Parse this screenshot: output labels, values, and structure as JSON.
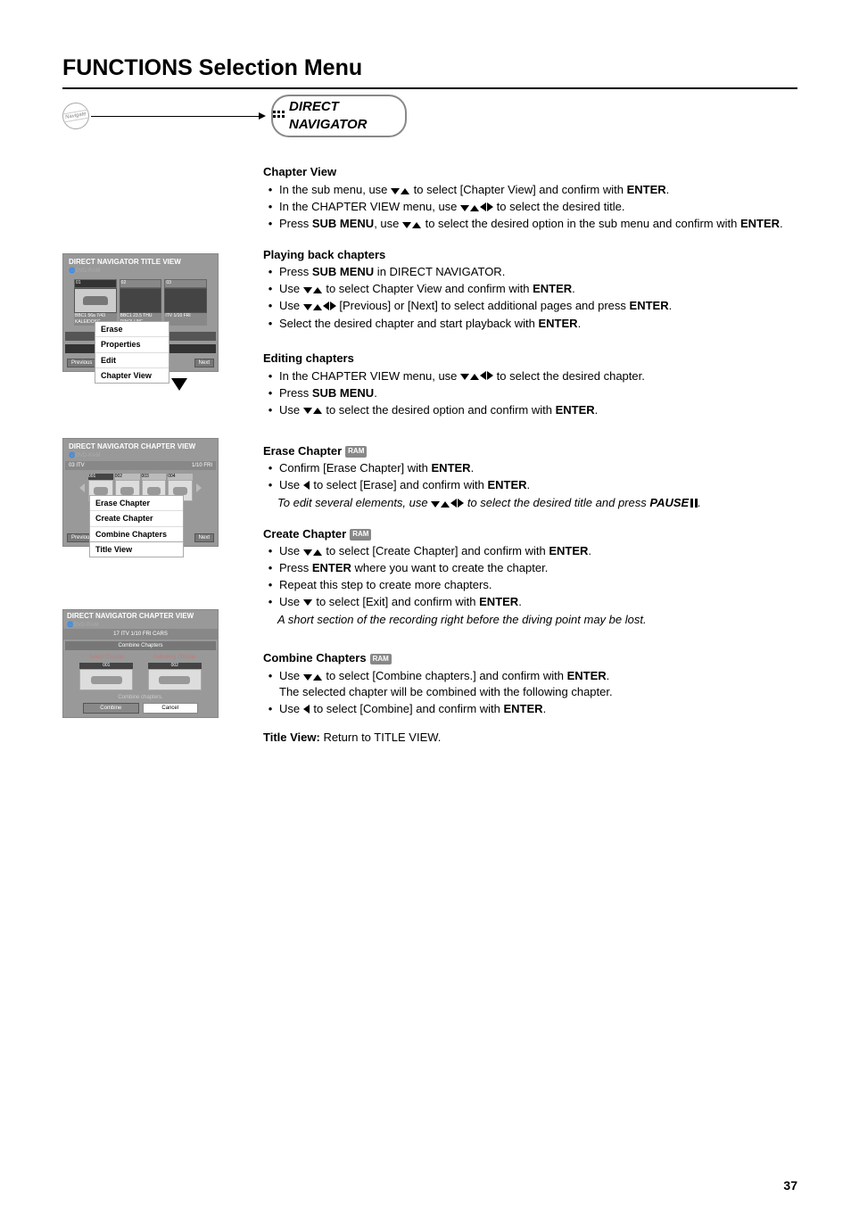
{
  "pageTitle": "FUNCTIONS Selection Menu",
  "navLabel": "DIRECT NAVIGATOR",
  "pageNumber": "37",
  "sections": {
    "chapterView": {
      "heading": "Chapter View",
      "b1_a": "In the sub menu, use ",
      "b1_b": " to select [Chapter View] and confirm with ",
      "b1_c": "ENTER",
      "b1_d": ".",
      "b2_a": "In the CHAPTER VIEW menu, use ",
      "b2_b": " to select the desired title.",
      "b3_a": "Press ",
      "b3_b": "SUB MENU",
      "b3_c": ", use ",
      "b3_d": " to select the desired option in the sub menu and confirm with ",
      "b3_e": "ENTER",
      "b3_f": "."
    },
    "playing": {
      "heading": "Playing back chapters",
      "b1_a": "Press ",
      "b1_b": "SUB MENU",
      "b1_c": " in DIRECT NAVIGATOR.",
      "b2_a": "Use ",
      "b2_b": " to select Chapter View and confirm with ",
      "b2_c": "ENTER",
      "b2_d": ".",
      "b3_a": "Use ",
      "b3_b": " [Previous] or [Next] to select additional pages and press ",
      "b3_c": "ENTER",
      "b3_d": ".",
      "b4": "Select the desired chapter and start playback with ",
      "b4_b": "ENTER",
      "b4_c": "."
    },
    "editing": {
      "heading": "Editing chapters",
      "b1_a": "In the CHAPTER VIEW menu, use ",
      "b1_b": " to select the desired chapter.",
      "b2_a": "Press ",
      "b2_b": "SUB MENU",
      "b2_c": ".",
      "b3_a": "Use ",
      "b3_b": " to select the desired option and confirm with ",
      "b3_c": "ENTER",
      "b3_d": "."
    },
    "erase": {
      "heading": "Erase Chapter",
      "b1_a": "Confirm [Erase Chapter] with ",
      "b1_b": "ENTER",
      "b1_c": ".",
      "b2_a": "Use ",
      "b2_b": " to select [Erase] and confirm with ",
      "b2_c": "ENTER",
      "b2_d": ".",
      "note_a": "To edit several elements, use ",
      "note_b": " to select the desired title and press ",
      "note_c": "PAUSE",
      "note_d": "."
    },
    "create": {
      "heading": "Create Chapter",
      "b1_a": "Use ",
      "b1_b": " to select [Create Chapter] and confirm with ",
      "b1_c": "ENTER",
      "b1_d": ".",
      "b2_a": "Press ",
      "b2_b": "ENTER",
      "b2_c": " where you want to create the chapter.",
      "b3": "Repeat this step to create more chapters.",
      "b4_a": "Use ",
      "b4_b": " to select [Exit] and confirm with ",
      "b4_c": "ENTER",
      "b4_d": ".",
      "note": "A short section of the recording right before the diving point may be lost."
    },
    "combine": {
      "heading": "Combine Chapters",
      "b1_a": "Use ",
      "b1_b": " to select [Combine chapters.] and confirm with ",
      "b1_c": "ENTER",
      "b1_d": ".",
      "b1_e": "The selected chapter will be combined with the following chapter.",
      "b2_a": "Use ",
      "b2_b": " to select [Combine] and confirm with ",
      "b2_c": "ENTER",
      "b2_d": "."
    },
    "titleView": {
      "label": "Title View:",
      "text": " Return to TITLE VIEW."
    }
  },
  "shot1": {
    "title": "DIRECT NAVIGATOR TITLE VIEW",
    "media": "DVD-RAM",
    "cell1_top": "01",
    "cell2_top": "02",
    "cell3_top": "03",
    "cell1_cap1": "BBC1   56a  7/43",
    "cell1_cap2": "KALEIDOSC",
    "cell2_cap1": "BBC1   23.5 THU",
    "cell2_cap2": "DINOLUNE",
    "cell3_cap1": "ITV     1/10 FRI",
    "prev": "Previous",
    "next": "Next",
    "menu": [
      "Erase",
      "Properties",
      "Edit",
      "Chapter View"
    ]
  },
  "shot2": {
    "title": "DIRECT NAVIGATOR CHAPTER VIEW",
    "media": "DVD-RAM",
    "barLeft": "03   ITV",
    "barRight": "1/10 FRI",
    "labels": [
      "001",
      "002",
      "003",
      "004"
    ],
    "prev": "Previous",
    "next": "Next",
    "menu": [
      "Erase Chapter",
      "Create Chapter",
      "Combine Chapters",
      "Title View"
    ]
  },
  "shot3": {
    "title": "DIRECT NAVIGATOR CHAPTER VIEW",
    "media": "DVD-RAM",
    "headerRow": "17  ITV   1/10 FRI   CARS",
    "subHeader": "Combine Chapters",
    "selLabel": "Select Chapter",
    "folLabel": "Following Chapter",
    "tag1": "001",
    "tag2": "002",
    "note": "Combine chapters.",
    "btnCombine": "Combine",
    "btnCancel": "Cancel"
  },
  "ramBadge": "RAM"
}
